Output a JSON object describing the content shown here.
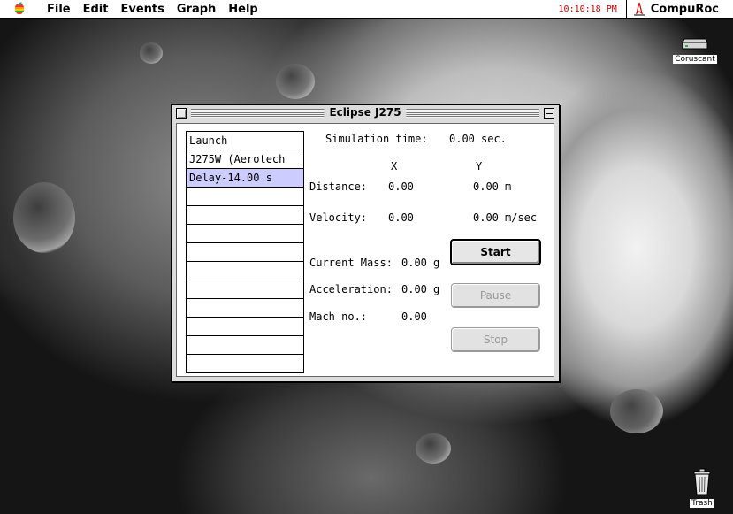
{
  "menubar": {
    "items": [
      "File",
      "Edit",
      "Events",
      "Graph",
      "Help"
    ],
    "clock": "10:10:18 PM",
    "active_app": "CompuRoc"
  },
  "desktop": {
    "icons": [
      {
        "label": "Coruscant",
        "icon": "hard-disk-icon"
      },
      {
        "label": "Trash",
        "icon": "trash-icon"
      }
    ]
  },
  "window": {
    "title": "Eclipse J275",
    "list": [
      "Launch",
      "J275W (Aerotech",
      "Delay-14.00 s",
      "",
      "",
      "",
      "",
      "",
      "",
      "",
      "",
      "",
      ""
    ],
    "selected_index": 2,
    "simulation": {
      "label": "Simulation time:",
      "value": "0.00",
      "unit": "sec."
    },
    "col_x": "X",
    "col_y": "Y",
    "distance": {
      "label": "Distance:",
      "x": "0.00",
      "y": "0.00",
      "unit": "m"
    },
    "velocity": {
      "label": "Velocity:",
      "x": "0.00",
      "y": "0.00",
      "unit": "m/sec"
    },
    "mass": {
      "label": "Current Mass:",
      "value": "0.00",
      "unit": "g"
    },
    "acceleration": {
      "label": "Acceleration:",
      "value": "0.00",
      "unit": "g"
    },
    "mach": {
      "label": "Mach no.:",
      "value": "0.00"
    },
    "buttons": {
      "start": "Start",
      "pause": "Pause",
      "stop": "Stop"
    }
  },
  "colors": {
    "clock": "#c00000",
    "selection": "#ccccff"
  }
}
